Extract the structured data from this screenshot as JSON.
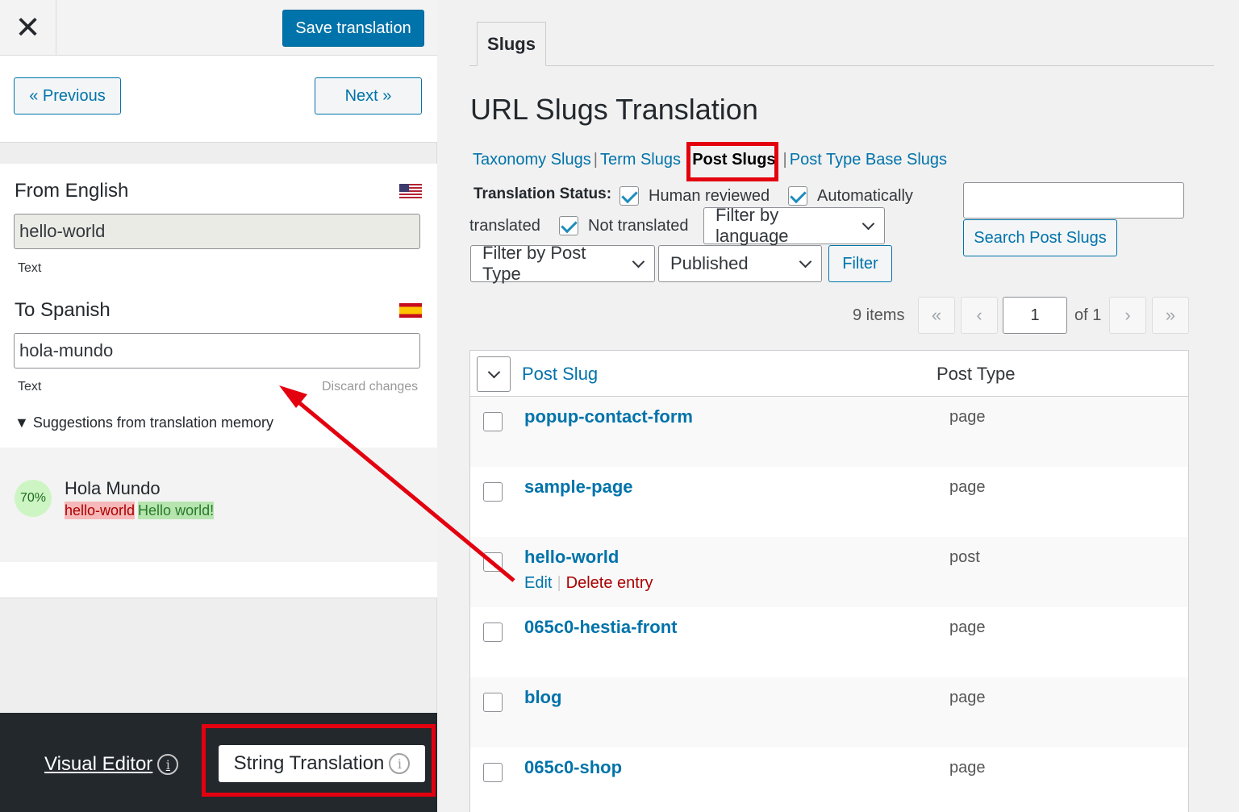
{
  "left_panel": {
    "save_label": "Save translation",
    "prev_label": "« Previous",
    "next_label": "Next »",
    "from_label": "From English",
    "from_value": "hello-world",
    "from_type": "Text",
    "to_label": "To Spanish",
    "to_value": "hola-mundo",
    "to_type": "Text",
    "discard_label": "Discard changes",
    "suggestions_label": "Suggestions from translation memory",
    "memory": {
      "percent": "70%",
      "title": "Hola Mundo",
      "removed": "hello-world",
      "added": "Hello world!"
    },
    "visual_editor_label": "Visual Editor",
    "string_translation_label": "String Translation"
  },
  "right_panel": {
    "tab_label": "Slugs",
    "page_title": "URL Slugs Translation",
    "views": [
      "Taxonomy Slugs",
      "Term Slugs",
      "Post Slugs",
      "Post Type Base Slugs"
    ],
    "status_label": "Translation Status:",
    "status_options": {
      "human_reviewed": "Human reviewed",
      "automatically": "Automatically",
      "translated": "translated",
      "not_translated": "Not translated"
    },
    "filter_language": "Filter by language",
    "filter_post_type": "Filter by Post Type",
    "published": "Published",
    "filter_button": "Filter",
    "search_button": "Search Post Slugs",
    "items_count": "9 items",
    "pagination": {
      "first": "«",
      "prev": "‹",
      "current": "1",
      "of": "of 1",
      "next": "›",
      "last": "»"
    },
    "columns": {
      "slug": "Post Slug",
      "type": "Post Type"
    },
    "rows": [
      {
        "slug": "popup-contact-form",
        "type": "page"
      },
      {
        "slug": "sample-page",
        "type": "page"
      },
      {
        "slug": "hello-world",
        "type": "post",
        "edit": "Edit",
        "delete": "Delete entry"
      },
      {
        "slug": "065c0-hestia-front",
        "type": "page"
      },
      {
        "slug": "blog",
        "type": "page"
      },
      {
        "slug": "065c0-shop",
        "type": "page"
      }
    ]
  },
  "colors": {
    "primary": "#0073aa",
    "highlight_red": "#e3000f",
    "dark_bar": "#23282d",
    "delete_link": "#aa0000"
  }
}
